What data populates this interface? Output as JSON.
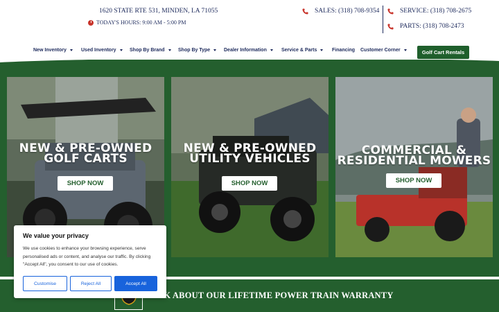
{
  "header": {
    "address": "1620 STATE RTE 531, MINDEN, LA 71055",
    "hours": "TODAY'S HOURS: 9:00 AM - 5:00 PM",
    "sales": "SALES: (318) 708-9354",
    "service": "SERVICE: (318) 708-2675",
    "parts": "PARTS: (318) 708-2473"
  },
  "nav": {
    "items": [
      {
        "label": "New Inventory"
      },
      {
        "label": "Used Inventory"
      },
      {
        "label": "Shop By Brand"
      },
      {
        "label": "Shop By Type"
      },
      {
        "label": "Dealer Information"
      },
      {
        "label": "Service & Parts"
      },
      {
        "label": "Financing"
      },
      {
        "label": "Customer Corner"
      }
    ],
    "cta": "Golf Cart Rentals"
  },
  "cards": [
    {
      "line1": "NEW & PRE-OWNED",
      "line2": "GOLF CARTS",
      "button": "SHOP NOW"
    },
    {
      "line1": "NEW & PRE-OWNED",
      "line2": "UTILITY VEHICLES",
      "button": "SHOP NOW"
    },
    {
      "line1": "COMMERCIAL &",
      "line2": "RESIDENTIAL MOWERS",
      "button": "SHOP NOW"
    }
  ],
  "warranty": "ASK ABOUT OUR LIFETIME POWER TRAIN WARRANTY",
  "cookie": {
    "title": "We value your privacy",
    "text": "We use cookies to enhance your browsing experience, serve personalised ads or content, and analyse our traffic. By clicking \"Accept All\", you consent to our use of cookies.",
    "customise": "Customise",
    "reject": "Reject All",
    "accept": "Accept All"
  },
  "colors": {
    "brand_green": "#245f2e",
    "navy": "#1d2a5c",
    "accent_red": "#c8342b",
    "cookie_blue": "#1863dc"
  }
}
